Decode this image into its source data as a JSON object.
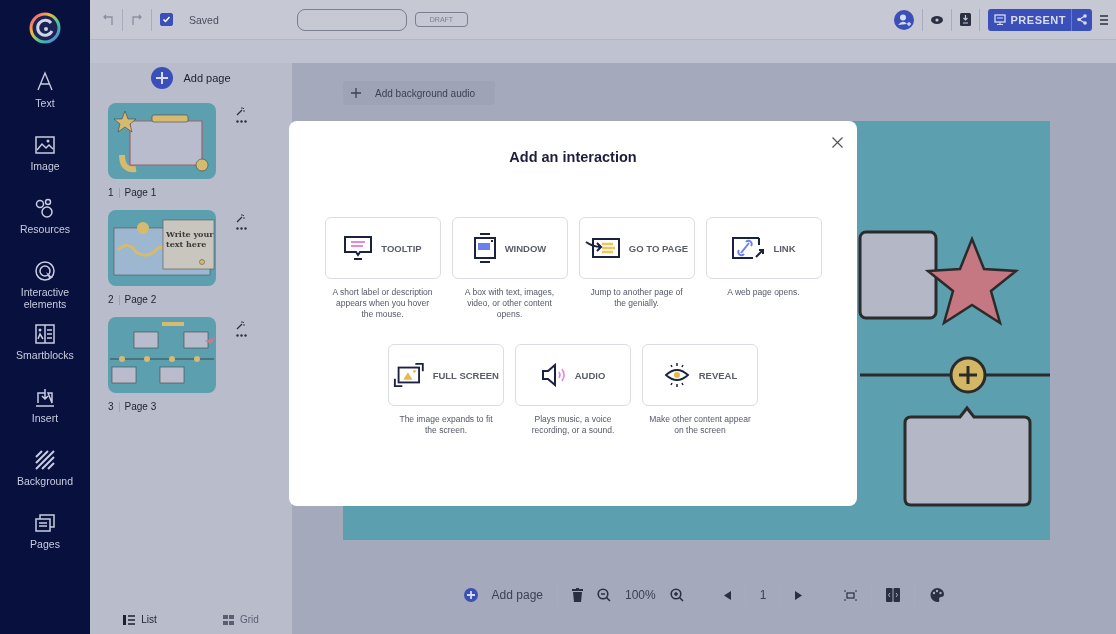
{
  "sidebar": {
    "items": [
      {
        "label": "Text"
      },
      {
        "label": "Image"
      },
      {
        "label": "Resources"
      },
      {
        "label": "Interactive elements"
      },
      {
        "label": "Smartblocks"
      },
      {
        "label": "Insert"
      },
      {
        "label": "Background"
      },
      {
        "label": "Pages"
      }
    ]
  },
  "topbar": {
    "autosave": {
      "label": "Saved",
      "checked": true
    },
    "draft_badge": "DRAFT",
    "present_button": "PRESENT"
  },
  "pages_panel": {
    "add_page": "Add page",
    "pages": [
      {
        "number": "1",
        "name": "Page 1"
      },
      {
        "number": "2",
        "name": "Page 2",
        "thumbnail_text": "Write your text here"
      },
      {
        "number": "3",
        "name": "Page 3"
      }
    ],
    "view_tabs": [
      {
        "label": "List",
        "selected": true
      },
      {
        "label": "Grid",
        "selected": false
      }
    ]
  },
  "workspace": {
    "add_background_audio": "Add background audio"
  },
  "bottom_toolbar": {
    "add_page": "Add page",
    "zoom": "100%",
    "page_number": "1"
  },
  "modal": {
    "title": "Add an interaction",
    "option_rows": [
      {
        "options": [
          {
            "kind": "tooltip",
            "label": "TOOLTIP",
            "description": "A short label or description appears when you hover the mouse."
          },
          {
            "kind": "window",
            "label": "WINDOW",
            "description": "A box with text, images, video, or other content opens."
          },
          {
            "kind": "goto",
            "label": "GO TO PAGE",
            "description": "Jump to another page of the genially."
          },
          {
            "kind": "link",
            "label": "LINK",
            "description": "A web page opens."
          }
        ]
      },
      {
        "options": [
          {
            "kind": "fullscreen",
            "label": "FULL SCREEN",
            "description": "The image expands to fit the screen."
          },
          {
            "kind": "audio",
            "label": "AUDIO",
            "description": "Plays music, a voice recording, or a sound."
          },
          {
            "kind": "reveal",
            "label": "REVEAL",
            "description": "Make other content appear on the screen"
          }
        ]
      }
    ]
  }
}
